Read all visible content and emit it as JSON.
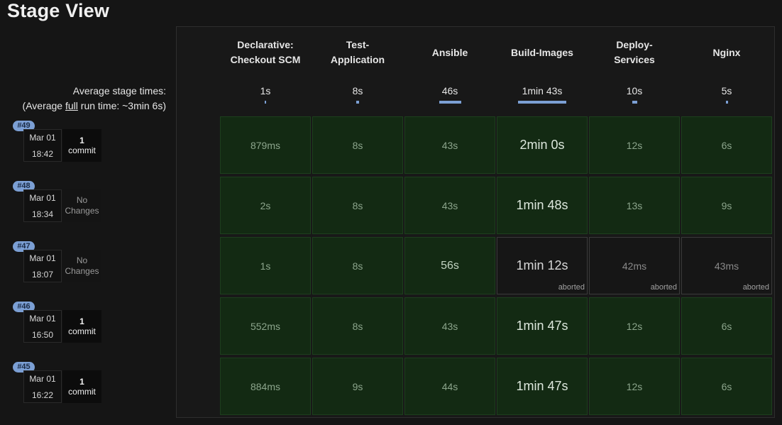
{
  "title": "Stage View",
  "average": {
    "label": "Average stage times:",
    "full_prefix": "(Average ",
    "full_link": "full",
    "full_suffix": " run time: ~3min 6s)"
  },
  "stages": [
    {
      "name_line1": "Declarative:",
      "name_line2": "Checkout SCM",
      "avg": "1s",
      "avg_fraction": 0.01
    },
    {
      "name_line1": "Test-",
      "name_line2": "Application",
      "avg": "8s",
      "avg_fraction": 0.06
    },
    {
      "name_line1": "Ansible",
      "name_line2": "",
      "avg": "46s",
      "avg_fraction": 0.45
    },
    {
      "name_line1": "Build-Images",
      "name_line2": "",
      "avg": "1min 43s",
      "avg_fraction": 1.0
    },
    {
      "name_line1": "Deploy-",
      "name_line2": "Services",
      "avg": "10s",
      "avg_fraction": 0.1
    },
    {
      "name_line1": "Nginx",
      "name_line2": "",
      "avg": "5s",
      "avg_fraction": 0.05
    }
  ],
  "runs": [
    {
      "number": "#49",
      "date": "Mar 01",
      "time": "18:42",
      "changes_count": "1",
      "changes_label": "commit",
      "has_commit": true,
      "cells": [
        {
          "text": "879ms"
        },
        {
          "text": "8s"
        },
        {
          "text": "43s"
        },
        {
          "text": "2min 0s"
        },
        {
          "text": "12s"
        },
        {
          "text": "6s"
        }
      ]
    },
    {
      "number": "#48",
      "date": "Mar 01",
      "time": "18:34",
      "changes_count": "No",
      "changes_label": "Changes",
      "has_commit": false,
      "cells": [
        {
          "text": "2s"
        },
        {
          "text": "8s"
        },
        {
          "text": "43s"
        },
        {
          "text": "1min 48s"
        },
        {
          "text": "13s"
        },
        {
          "text": "9s"
        }
      ]
    },
    {
      "number": "#47",
      "date": "Mar 01",
      "time": "18:07",
      "changes_count": "No",
      "changes_label": "Changes",
      "has_commit": false,
      "cells": [
        {
          "text": "1s"
        },
        {
          "text": "8s"
        },
        {
          "text": "56s"
        },
        {
          "text": "1min 12s",
          "status": "aborted"
        },
        {
          "text": "42ms",
          "status": "aborted"
        },
        {
          "text": "43ms",
          "status": "aborted"
        }
      ]
    },
    {
      "number": "#46",
      "date": "Mar 01",
      "time": "16:50",
      "changes_count": "1",
      "changes_label": "commit",
      "has_commit": true,
      "cells": [
        {
          "text": "552ms"
        },
        {
          "text": "8s"
        },
        {
          "text": "43s"
        },
        {
          "text": "1min 47s"
        },
        {
          "text": "12s"
        },
        {
          "text": "6s"
        }
      ]
    },
    {
      "number": "#45",
      "date": "Mar 01",
      "time": "16:22",
      "changes_count": "1",
      "changes_label": "commit",
      "has_commit": true,
      "cells": [
        {
          "text": "884ms"
        },
        {
          "text": "9s"
        },
        {
          "text": "44s"
        },
        {
          "text": "1min 47s"
        },
        {
          "text": "12s"
        },
        {
          "text": "6s"
        }
      ]
    }
  ],
  "colors": {
    "success_cell": "#132a13",
    "aborted_cell": "#161616",
    "badge": "#7b9fd4",
    "bar": "#7b9fd4"
  }
}
